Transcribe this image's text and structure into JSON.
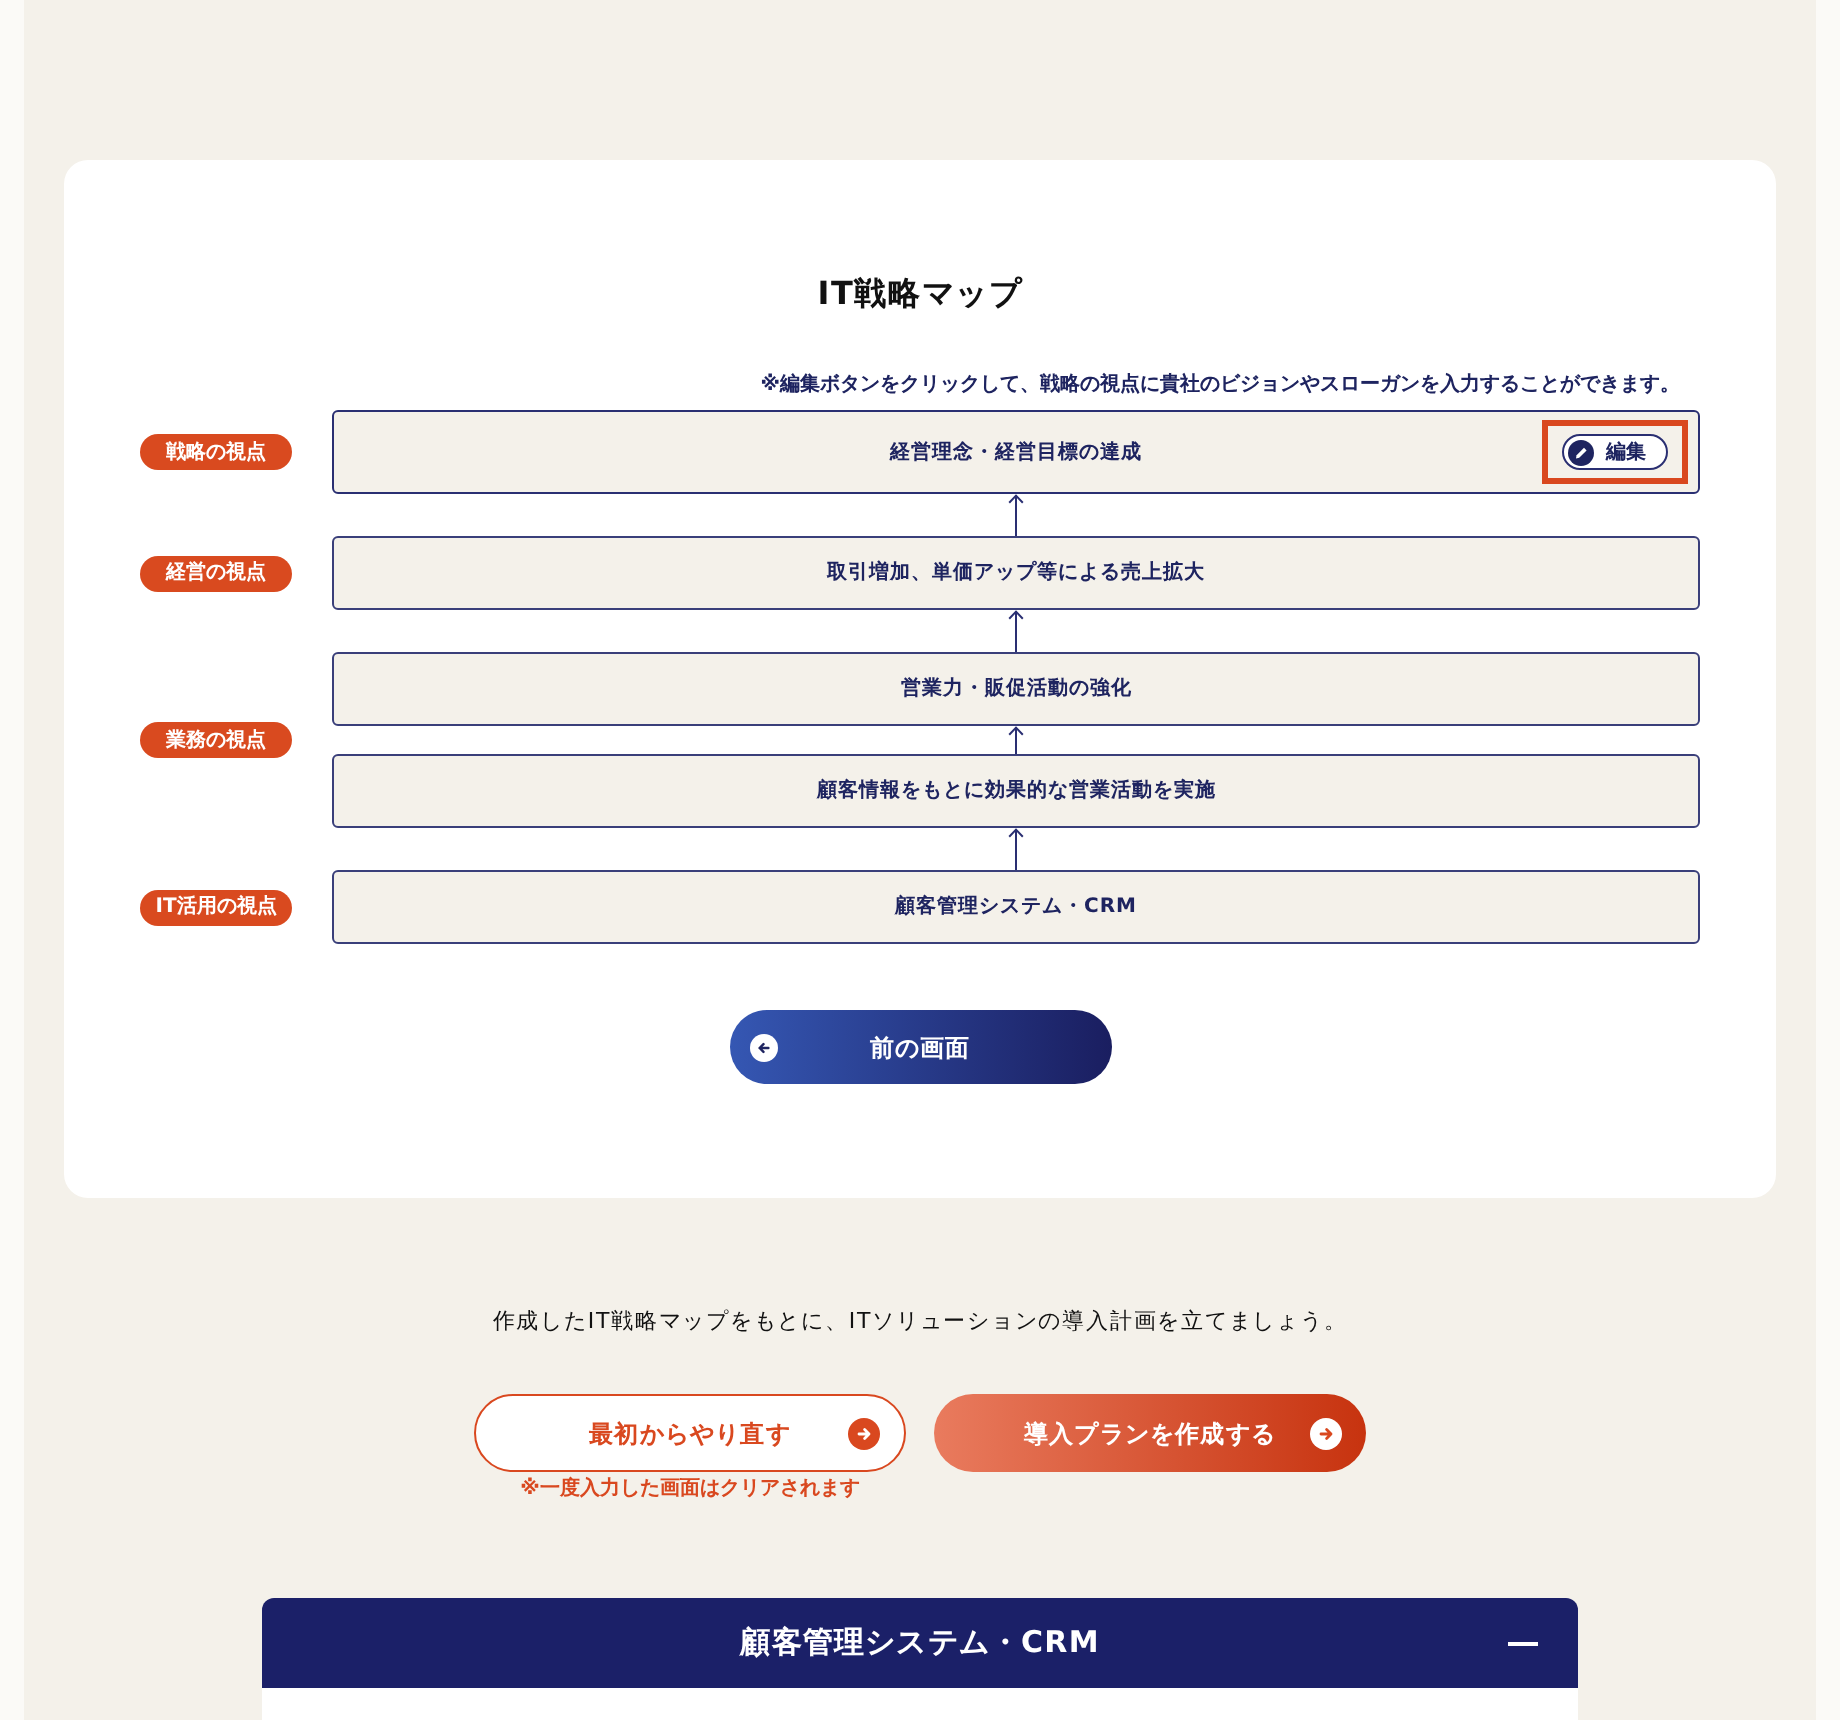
{
  "title": "IT戦略マップ",
  "hint": "※編集ボタンをクリックして、戦略の視点に貴社のビジョンやスローガンを入力することができます。",
  "perspectives": [
    {
      "label": "戦略の視点",
      "items": [
        {
          "text": "経営理念・経営目標の達成",
          "edit_button": {
            "label": "編集",
            "highlighted": true
          }
        }
      ]
    },
    {
      "label": "経営の視点",
      "items": [
        {
          "text": "取引増加、単価アップ等による売上拡大"
        }
      ]
    },
    {
      "label": "業務の視点",
      "items": [
        {
          "text": "営業力・販促活動の強化"
        },
        {
          "text": "顧客情報をもとに効果的な営業活動を実施"
        }
      ]
    },
    {
      "label": "IT活用の視点",
      "items": [
        {
          "text": "顧客管理システム・CRM"
        }
      ]
    }
  ],
  "back_button": {
    "label": "前の画面"
  },
  "instruction": "作成したIT戦略マップをもとに、ITソリューションの導入計画を立てましょう。",
  "actions": [
    {
      "kind": "outline",
      "label": "最初からやり直す",
      "note": "※一度入力した画面はクリアされます"
    },
    {
      "kind": "filled",
      "label": "導入プランを作成する"
    }
  ],
  "accordion": {
    "title": "顧客管理システム・CRM",
    "expanded": true
  }
}
